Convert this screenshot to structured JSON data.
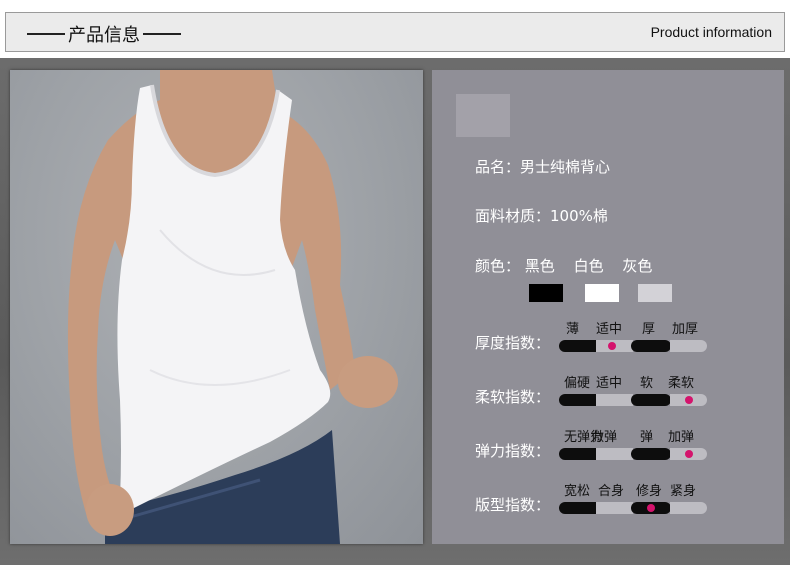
{
  "header": {
    "title_cn": "产品信息",
    "title_en": "Product information"
  },
  "specs": {
    "name": "品名：男士纯棉背心",
    "material": "面料材质：100%棉",
    "color_label": "颜色：",
    "colors": [
      {
        "name": "黑色",
        "hex": "#000000"
      },
      {
        "name": "白色",
        "hex": "#ffffff"
      },
      {
        "name": "灰色",
        "hex": "#d3d2d7"
      }
    ]
  },
  "indices": [
    {
      "label": "厚度指数：",
      "scale": [
        "薄",
        "适中",
        "厚",
        "加厚"
      ],
      "selected_index": 1
    },
    {
      "label": "柔软指数：",
      "scale": [
        "偏硬",
        "适中",
        "软",
        "柔软"
      ],
      "selected_index": 3
    },
    {
      "label": "弹力指数：",
      "scale": [
        "无弹力",
        "微弹",
        "弹",
        "加弹"
      ],
      "selected_index": 3
    },
    {
      "label": "版型指数：",
      "scale": [
        "宽松",
        "合身",
        "修身",
        "紧身"
      ],
      "selected_index": 2
    }
  ],
  "accent_color": "#d4136c"
}
